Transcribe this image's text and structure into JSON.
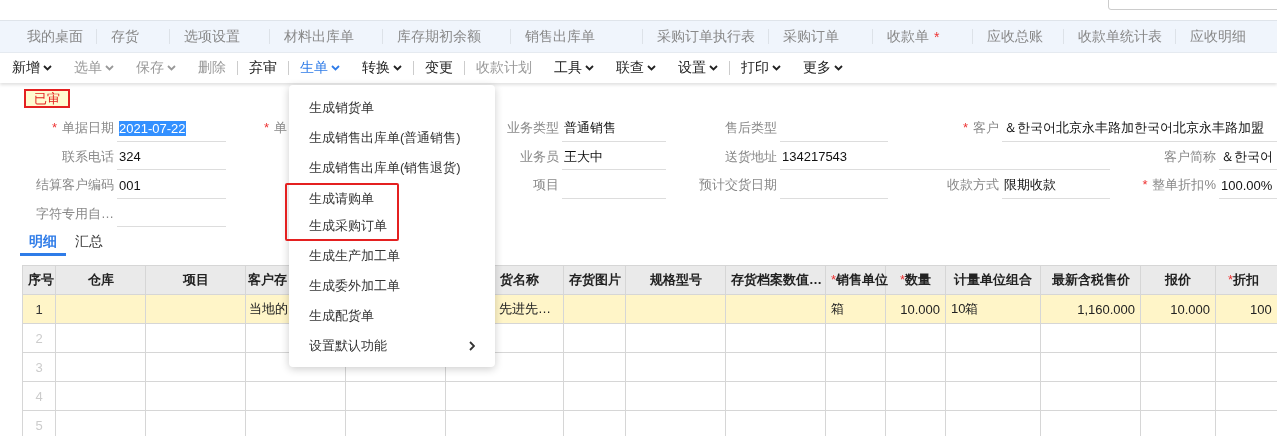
{
  "tabs": [
    {
      "label": "我的桌面",
      "selected": false
    },
    {
      "label": "存货",
      "selected": false
    },
    {
      "label": "选项设置",
      "selected": false
    },
    {
      "label": "材料出库单",
      "selected": false
    },
    {
      "label": "库存期初余额",
      "selected": false
    },
    {
      "label": "销售出库单",
      "selected": false
    },
    {
      "label": "采购订单执行表",
      "selected": false
    },
    {
      "label": "采购订单",
      "selected": false
    },
    {
      "label": "收款单",
      "selected": false,
      "badge": "*"
    },
    {
      "label": "应收总账",
      "selected": false
    },
    {
      "label": "收款单统计表",
      "selected": false
    },
    {
      "label": "应收明细",
      "selected": false
    }
  ],
  "toolbar": [
    {
      "kind": "button",
      "label": "新增",
      "has_menu": true,
      "disabled": false,
      "open": false
    },
    {
      "kind": "button",
      "label": "选单",
      "has_menu": true,
      "disabled": true,
      "open": false
    },
    {
      "kind": "button",
      "label": "保存",
      "has_menu": true,
      "disabled": true,
      "open": false
    },
    {
      "kind": "button",
      "label": "删除",
      "has_menu": false,
      "disabled": true,
      "open": false
    },
    {
      "kind": "separator"
    },
    {
      "kind": "button",
      "label": "弃审",
      "has_menu": false,
      "disabled": false,
      "open": false
    },
    {
      "kind": "separator"
    },
    {
      "kind": "button",
      "label": "生单",
      "has_menu": true,
      "disabled": false,
      "open": true
    },
    {
      "kind": "button",
      "label": "转换",
      "has_menu": true,
      "disabled": false,
      "open": false
    },
    {
      "kind": "separator"
    },
    {
      "kind": "button",
      "label": "变更",
      "has_menu": false,
      "disabled": false,
      "open": false
    },
    {
      "kind": "separator"
    },
    {
      "kind": "button",
      "label": "收款计划",
      "has_menu": false,
      "disabled": true,
      "open": false
    },
    {
      "kind": "button",
      "label": "工具",
      "has_menu": true,
      "disabled": false,
      "open": false
    },
    {
      "kind": "button",
      "label": "联查",
      "has_menu": true,
      "disabled": false,
      "open": false
    },
    {
      "kind": "button",
      "label": "设置",
      "has_menu": true,
      "disabled": false,
      "open": false
    },
    {
      "kind": "separator"
    },
    {
      "kind": "button",
      "label": "打印",
      "has_menu": true,
      "disabled": false,
      "open": false
    },
    {
      "kind": "button",
      "label": "更多",
      "has_menu": true,
      "disabled": false,
      "open": false
    }
  ],
  "status_badge": "已审",
  "form": {
    "rows": [
      [
        {
          "label": "单据日期",
          "required": true,
          "value": "2021-07-22",
          "text_selected": true
        },
        {
          "label": "单",
          "required": true
        },
        {
          "label": "业务类型",
          "required": false,
          "value": "普通销售",
          "text_selected": false
        },
        {
          "label": "售后类型",
          "required": false
        },
        {
          "label": "客户",
          "required": true,
          "value": "＆한국어北京永丰路加한국어北京永丰路加盟",
          "text_selected": false
        }
      ],
      [
        {
          "label": "联系电话",
          "required": false,
          "value": "324",
          "text_selected": false
        },
        "",
        {
          "label": "业务员",
          "required": false,
          "value": "王大中",
          "text_selected": false
        },
        {
          "label": "送货地址",
          "required": false,
          "value": "134217543",
          "text_selected": false
        },
        "",
        {
          "label": "客户简称",
          "required": false,
          "value": "＆한국어",
          "text_selected": false
        }
      ],
      [
        {
          "label": "结算客户编码",
          "required": false,
          "value": "001",
          "text_selected": false
        },
        "",
        {
          "label": "项目",
          "required": false
        },
        {
          "label": "预计交货日期",
          "required": false
        },
        {
          "label": "收款方式",
          "required": false,
          "value": "限期收款",
          "text_selected": false
        },
        {
          "label": "整单折扣%",
          "required": true,
          "value": "100.00%",
          "text_selected": false
        }
      ],
      [
        {
          "label": "字符专用自…",
          "required": false
        }
      ]
    ]
  },
  "detail_tabs": [
    {
      "label": "明细",
      "selected": true
    },
    {
      "label": "汇总",
      "selected": false
    }
  ],
  "table": {
    "columns": [
      {
        "label": "序号",
        "required": false
      },
      {
        "label": "仓库",
        "required": false
      },
      {
        "label": "项目",
        "required": false
      },
      {
        "label": "客户存",
        "required": false
      },
      null,
      {
        "label": "货名称",
        "required": false
      },
      {
        "label": "存货图片",
        "required": false
      },
      {
        "label": "规格型号",
        "required": false
      },
      {
        "label": "存货档案数值…",
        "required": false
      },
      {
        "label": "销售单位",
        "required": true
      },
      {
        "label": "数量",
        "required": true
      },
      {
        "label": "计量单位组合",
        "required": false
      },
      {
        "label": "最新含税售价",
        "required": false
      },
      {
        "label": "报价",
        "required": false
      },
      {
        "label": "折扣",
        "required": true
      }
    ],
    "rows": [
      {
        "selected": true,
        "cells": [
          "1",
          "",
          "",
          "当地的",
          "",
          "先进先…",
          "",
          "",
          "",
          "箱",
          "10.000",
          "10箱",
          "1,160.000",
          "10.000",
          "100"
        ]
      },
      {
        "selected": false,
        "cells": [
          "2"
        ]
      },
      {
        "selected": false,
        "cells": [
          "3"
        ]
      },
      {
        "selected": false,
        "cells": [
          "4"
        ]
      },
      {
        "selected": false,
        "cells": [
          "5"
        ]
      }
    ]
  },
  "dropdown_menu": [
    {
      "label": "生成销货单",
      "highlighted": false,
      "has_submenu": false
    },
    {
      "label": "生成销售出库单(普通销售)",
      "highlighted": false,
      "has_submenu": false
    },
    {
      "label": "生成销售出库单(销售退货)",
      "highlighted": false,
      "has_submenu": false
    },
    {
      "label": "生成请购单",
      "highlighted": true,
      "has_submenu": false
    },
    {
      "label": "生成采购订单",
      "highlighted": true,
      "has_submenu": false
    },
    {
      "label": "生成生产加工单",
      "highlighted": false,
      "has_submenu": false
    },
    {
      "label": "生成委外加工单",
      "highlighted": false,
      "has_submenu": false
    },
    {
      "label": "生成配货单",
      "highlighted": false,
      "has_submenu": false
    },
    {
      "label": "设置默认功能",
      "highlighted": false,
      "has_submenu": true
    }
  ]
}
